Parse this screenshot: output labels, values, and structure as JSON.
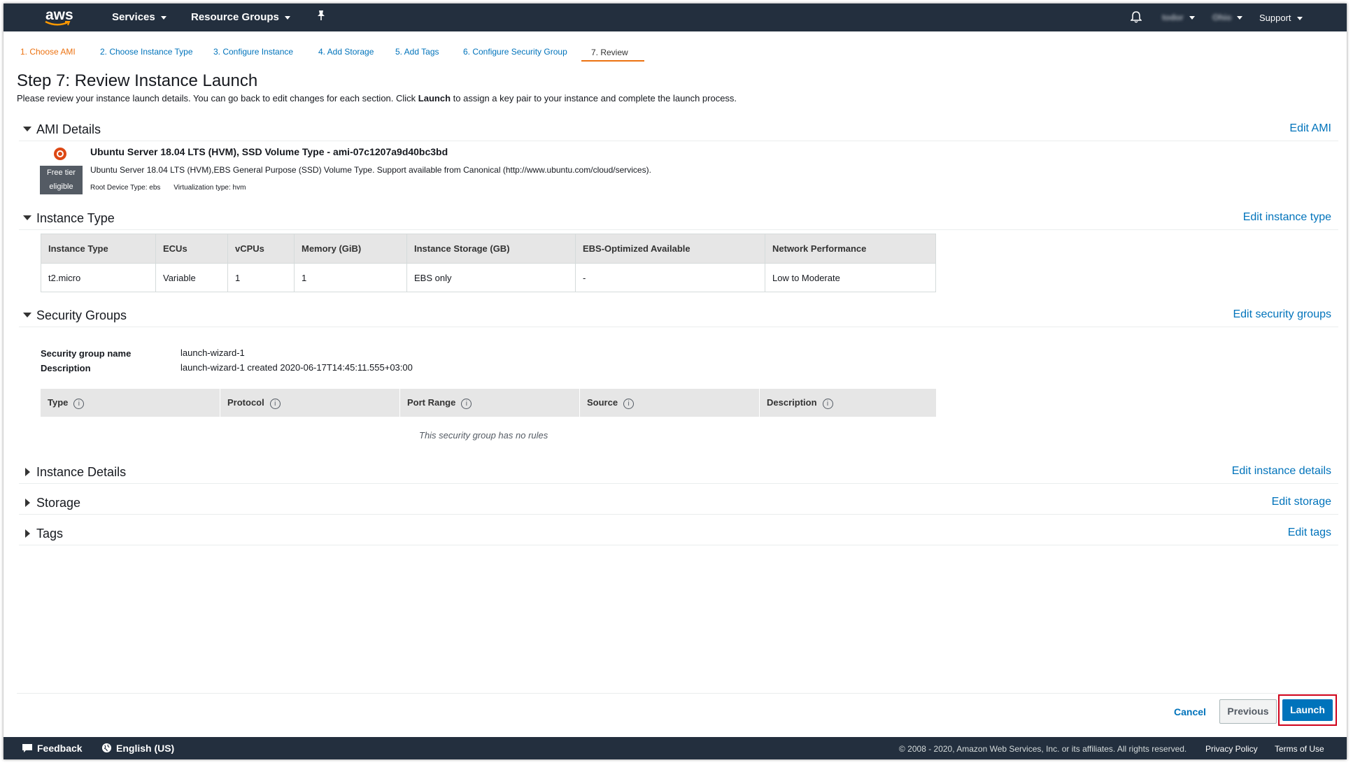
{
  "nav": {
    "logo": "aws",
    "services": "Services",
    "resource_groups": "Resource Groups",
    "pin_icon": "pin-icon",
    "bell_icon": "bell-icon",
    "account": "todor",
    "region": "Ohio",
    "support": "Support"
  },
  "tabs": [
    {
      "label": "1. Choose AMI"
    },
    {
      "label": "2. Choose Instance Type"
    },
    {
      "label": "3. Configure Instance"
    },
    {
      "label": "4. Add Storage"
    },
    {
      "label": "5. Add Tags"
    },
    {
      "label": "6. Configure Security Group"
    },
    {
      "label": "7. Review"
    }
  ],
  "page": {
    "title": "Step 7: Review Instance Launch",
    "intro_before": "Please review your instance launch details. You can go back to edit changes for each section. Click ",
    "intro_bold": "Launch",
    "intro_after": " to assign a key pair to your instance and complete the launch process."
  },
  "sections": {
    "ami": {
      "title": "AMI Details",
      "edit": "Edit AMI"
    },
    "instance_type": {
      "title": "Instance Type",
      "edit": "Edit instance type"
    },
    "security_groups": {
      "title": "Security Groups",
      "edit": "Edit security groups"
    },
    "instance_details": {
      "title": "Instance Details",
      "edit": "Edit instance details"
    },
    "storage": {
      "title": "Storage",
      "edit": "Edit storage"
    },
    "tags": {
      "title": "Tags",
      "edit": "Edit tags"
    }
  },
  "ami": {
    "free_tier_1": "Free tier",
    "free_tier_2": "eligible",
    "title": "Ubuntu Server 18.04 LTS (HVM), SSD Volume Type - ami-07c1207a9d40bc3bd",
    "description": "Ubuntu Server 18.04 LTS (HVM),EBS General Purpose (SSD) Volume Type. Support available from Canonical (http://www.ubuntu.com/cloud/services).",
    "root_device": "Root Device Type: ebs",
    "virtualization": "Virtualization type: hvm"
  },
  "instance_table": {
    "headers": [
      "Instance Type",
      "ECUs",
      "vCPUs",
      "Memory (GiB)",
      "Instance Storage (GB)",
      "EBS-Optimized Available",
      "Network Performance"
    ],
    "row": [
      "t2.micro",
      "Variable",
      "1",
      "1",
      "EBS only",
      "-",
      "Low to Moderate"
    ]
  },
  "security_group": {
    "name_label": "Security group name",
    "name_value": "launch-wizard-1",
    "desc_label": "Description",
    "desc_value": "launch-wizard-1 created 2020-06-17T14:45:11.555+03:00",
    "rule_headers": [
      "Type",
      "Protocol",
      "Port Range",
      "Source",
      "Description"
    ],
    "no_rules": "This security group has no rules"
  },
  "buttons": {
    "cancel": "Cancel",
    "previous": "Previous",
    "launch": "Launch"
  },
  "footer": {
    "feedback": "Feedback",
    "language": "English (US)",
    "copyright": "© 2008 - 2020, Amazon Web Services, Inc. or its affiliates. All rights reserved.",
    "privacy": "Privacy Policy",
    "terms": "Terms of Use"
  }
}
